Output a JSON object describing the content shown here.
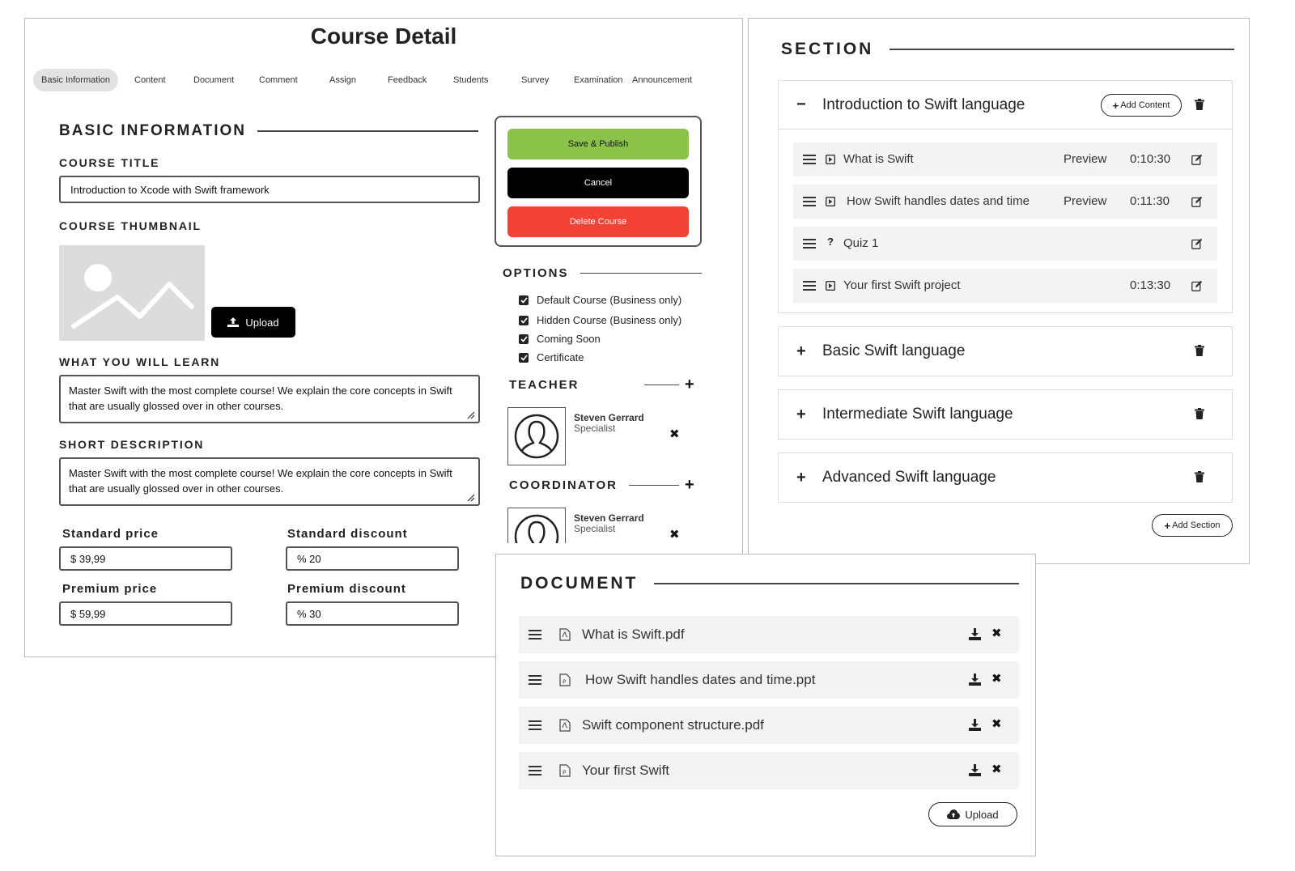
{
  "course": {
    "title": "Course Detail",
    "tabs": [
      "Basic Information",
      "Content",
      "Document",
      "Comment",
      "Assign",
      "Feedback",
      "Students",
      "Survey",
      "Examination",
      "Announcement"
    ],
    "active_tab": "Basic Information",
    "basic_info": {
      "heading": "BASIC INFORMATION",
      "course_title_label": "COURSE TITLE",
      "course_title_value": "Introduction to Xcode with Swift framework",
      "thumbnail_label": "COURSE THUMBNAIL",
      "upload_label": "Upload",
      "learn_label": "WHAT YOU WILL LEARN",
      "learn_value": "Master Swift with the most complete course! We explain the core concepts in Swift that are usually glossed over in other courses.",
      "short_desc_label": "SHORT DESCRIPTION",
      "short_desc_value": "Master Swift with the most complete course! We explain the core concepts in Swift that are usually glossed over in other courses.",
      "standard_price_label": "Standard price",
      "standard_price_value": "$ 39,99",
      "standard_discount_label": "Standard discount",
      "standard_discount_value": "% 20",
      "premium_price_label": "Premium price",
      "premium_price_value": "$ 59,99",
      "premium_discount_label": "Premium discount",
      "premium_discount_value": "% 30"
    },
    "actions": {
      "save_label": "Save & Publish",
      "cancel_label": "Cancel",
      "delete_label": "Delete Course"
    },
    "options": {
      "heading": "OPTIONS",
      "items": [
        "Default Course (Business only)",
        "Hidden Course (Business only)",
        "Coming Soon",
        "Certificate"
      ]
    },
    "teacher": {
      "heading": "TEACHER",
      "name": "Steven Gerrard",
      "role": "Specialist"
    },
    "coordinator": {
      "heading": "COORDINATOR",
      "name": "Steven Gerrard",
      "role": "Specialist"
    }
  },
  "section": {
    "heading": "SECTION",
    "sections": [
      {
        "title": "Introduction to Swift language",
        "expanded": true,
        "add_content_label": "Add Content",
        "lessons": [
          {
            "title": "What is Swift",
            "preview": "Preview",
            "duration": "0:10:30",
            "icon": "video-icon"
          },
          {
            "title": "How Swift handles dates and time",
            "preview": "Preview",
            "duration": "0:11:30",
            "icon": "video-icon"
          },
          {
            "title": "Quiz 1",
            "preview": "",
            "duration": "",
            "icon": "question-icon"
          },
          {
            "title": "Your first Swift project",
            "preview": "",
            "duration": "0:13:30",
            "icon": "video-icon"
          }
        ]
      },
      {
        "title": "Basic Swift language",
        "expanded": false
      },
      {
        "title": "Intermediate Swift language",
        "expanded": false
      },
      {
        "title": "Advanced Swift language",
        "expanded": false
      }
    ],
    "add_section_label": "Add Section"
  },
  "document": {
    "heading": "DOCUMENT",
    "files": [
      {
        "name": "What is Swift.pdf",
        "icon": "pdf-file-icon"
      },
      {
        "name": "How Swift handles dates and time.ppt",
        "icon": "ppt-file-icon"
      },
      {
        "name": "Swift component structure.pdf",
        "icon": "pdf-file-icon"
      },
      {
        "name": "Your first Swift",
        "icon": "ppt-file-icon"
      }
    ],
    "upload_label": "Upload"
  },
  "colors": {
    "save": "#8bc34a",
    "cancel": "#000000",
    "delete": "#f44336",
    "row_bg": "#f3f3f3"
  }
}
